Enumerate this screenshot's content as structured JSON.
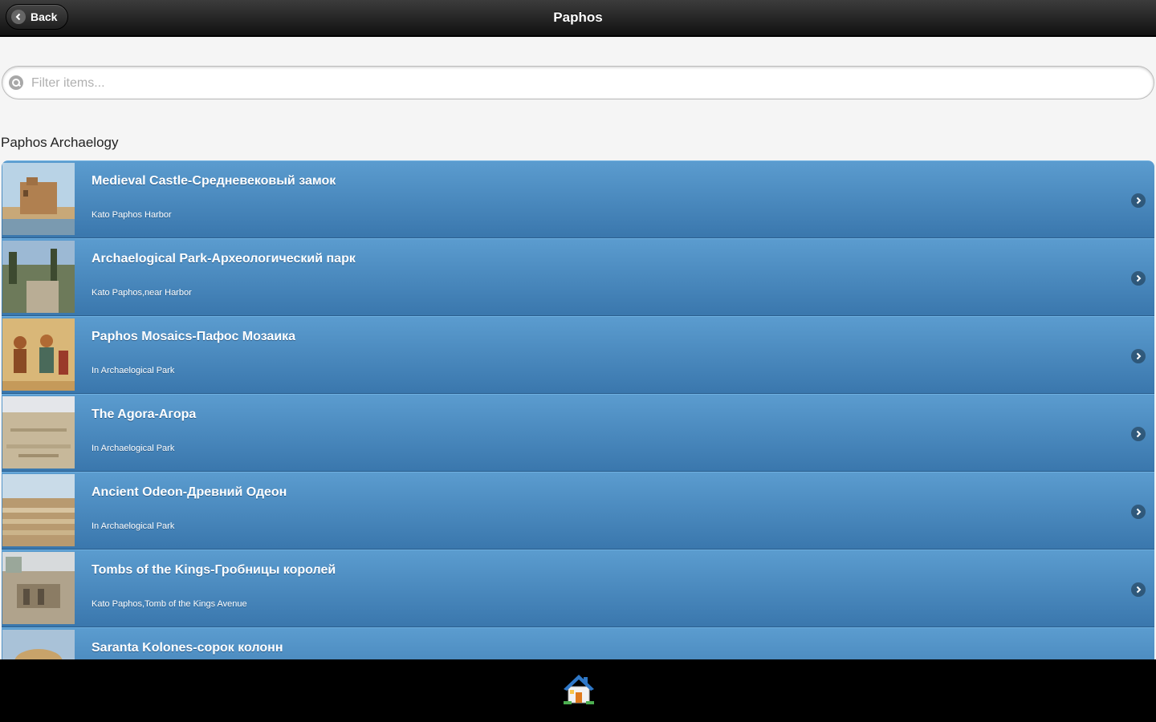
{
  "header": {
    "back_label": "Back",
    "title": "Paphos"
  },
  "search": {
    "placeholder": "Filter items...",
    "value": ""
  },
  "section": {
    "heading": "Paphos Archaelogy"
  },
  "items": [
    {
      "title": "Medieval Castle-Средневековый замок",
      "subtitle": "Kato Paphos Harbor",
      "thumb": "castle"
    },
    {
      "title": "Archaelogical Park-Археологический парк",
      "subtitle": "Kato Paphos,near Harbor",
      "thumb": "park"
    },
    {
      "title": "Paphos Mosaics-Пафос Мозаика",
      "subtitle": "In Archaelogical Park",
      "thumb": "mosaic"
    },
    {
      "title": "The Agora-Агора",
      "subtitle": "In Archaelogical Park",
      "thumb": "agora"
    },
    {
      "title": "Ancient Odeon-Древний Одеон",
      "subtitle": "In Archaelogical Park",
      "thumb": "odeon"
    },
    {
      "title": "Tombs of the Kings-Гробницы королей",
      "subtitle": "Kato Paphos,Tomb of the Kings Avenue",
      "thumb": "tombs"
    },
    {
      "title": "Saranta Kolones-сорок колонн",
      "subtitle": "",
      "thumb": "kolones"
    }
  ],
  "icons": {
    "back": "chevron-left-icon",
    "search": "search-icon",
    "arrow": "chevron-right-icon",
    "home": "home-icon"
  },
  "colors": {
    "header": "#1a1a1a",
    "list_item": "#4a88bf",
    "footer": "#000000"
  }
}
